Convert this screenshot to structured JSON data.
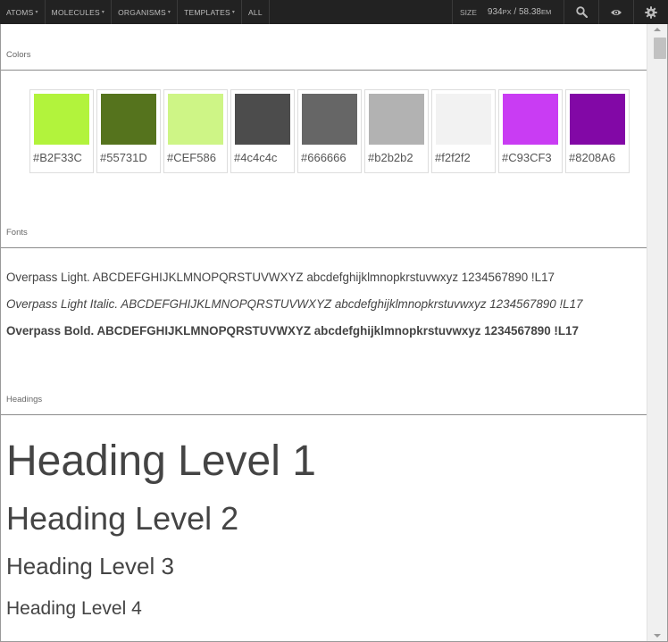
{
  "nav": {
    "items": [
      {
        "label": "ATOMS",
        "caret": "▾"
      },
      {
        "label": "MOLECULES",
        "caret": "▾"
      },
      {
        "label": "ORGANISMS",
        "caret": "▾"
      },
      {
        "label": "TEMPLATES",
        "caret": "▾"
      },
      {
        "label": "ALL",
        "caret": ""
      }
    ],
    "size_label": "SIZE",
    "size_px": "934",
    "size_px_unit": "PX",
    "size_sep": " / ",
    "size_em": "58.38",
    "size_em_unit": "EM",
    "icons": [
      "search-icon",
      "eye-icon",
      "gear-icon"
    ]
  },
  "sections": {
    "colors": "Colors",
    "fonts": "Fonts",
    "headings": "Headings"
  },
  "swatches": [
    {
      "code": "#B2F33C",
      "color": "#B2F33C"
    },
    {
      "code": "#55731D",
      "color": "#55731D"
    },
    {
      "code": "#CEF586",
      "color": "#CEF586"
    },
    {
      "code": "#4c4c4c",
      "color": "#4c4c4c"
    },
    {
      "code": "#666666",
      "color": "#666666"
    },
    {
      "code": "#b2b2b2",
      "color": "#b2b2b2"
    },
    {
      "code": "#f2f2f2",
      "color": "#f2f2f2"
    },
    {
      "code": "#C93CF3",
      "color": "#C93CF3"
    },
    {
      "code": "#8208A6",
      "color": "#8208A6"
    }
  ],
  "fonts": {
    "light": "Overpass Light. ABCDEFGHIJKLMNOPQRSTUVWXYZ abcdefghijklmnopkrstuvwxyz 1234567890 !L17",
    "light_italic": "Overpass Light Italic. ABCDEFGHIJKLMNOPQRSTUVWXYZ abcdefghijklmnopkrstuvwxyz 1234567890 !L17",
    "bold": "Overpass Bold. ABCDEFGHIJKLMNOPQRSTUVWXYZ abcdefghijklmnopkrstuvwxyz 1234567890 !L17"
  },
  "headings": {
    "h1": "Heading Level 1",
    "h2": "Heading Level 2",
    "h3": "Heading Level 3",
    "h4": "Heading Level 4"
  }
}
